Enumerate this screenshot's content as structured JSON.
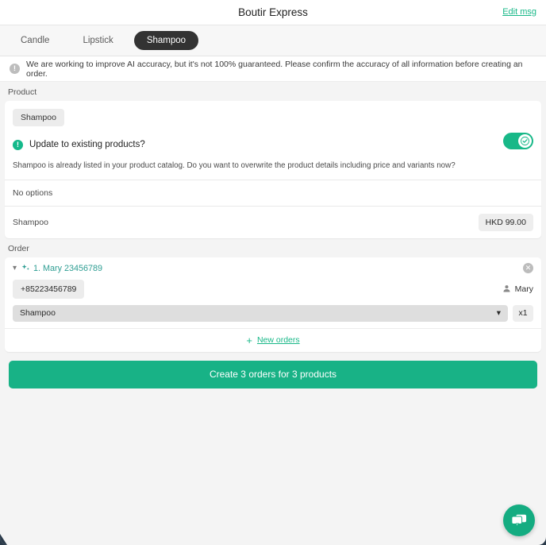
{
  "window": {
    "title": "Boutir Express",
    "edit_link": "Edit msg"
  },
  "tabs": [
    {
      "label": "Candle",
      "active": false
    },
    {
      "label": "Lipstick",
      "active": false
    },
    {
      "label": "Shampoo",
      "active": true
    }
  ],
  "notice": {
    "icon": "info-circle-icon",
    "text": "We are working to improve AI accuracy, but it's not 100% guaranteed. Please confirm the accuracy of all information before creating an order."
  },
  "product_section": {
    "label": "Product",
    "name_chip": "Shampoo",
    "update_prompt": {
      "icon": "info-circle-green-icon",
      "title": "Update to existing products?",
      "description": "Shampoo is already listed in your product catalog. Do you want to overwrite the product details including price and variants now?",
      "toggle_on": true
    },
    "options_row": "No options",
    "variant_row": {
      "name": "Shampoo",
      "price": "HKD 99.00"
    }
  },
  "order_section": {
    "label": "Order",
    "orders": [
      {
        "title": "1. Mary 23456789",
        "phone": "+85223456789",
        "customer": "Mary",
        "product": "Shampoo",
        "quantity": "x1"
      }
    ],
    "new_orders_label": "New orders"
  },
  "cta": {
    "label": "Create 3 orders for 3 products"
  },
  "fab": {
    "icon": "chat-bubbles-icon"
  },
  "colors": {
    "brand_green": "#18b888",
    "cta_green": "#18b286",
    "teal_link": "#2f9e93",
    "active_tab": "#333333",
    "page_bg": "#f4f4f4"
  }
}
